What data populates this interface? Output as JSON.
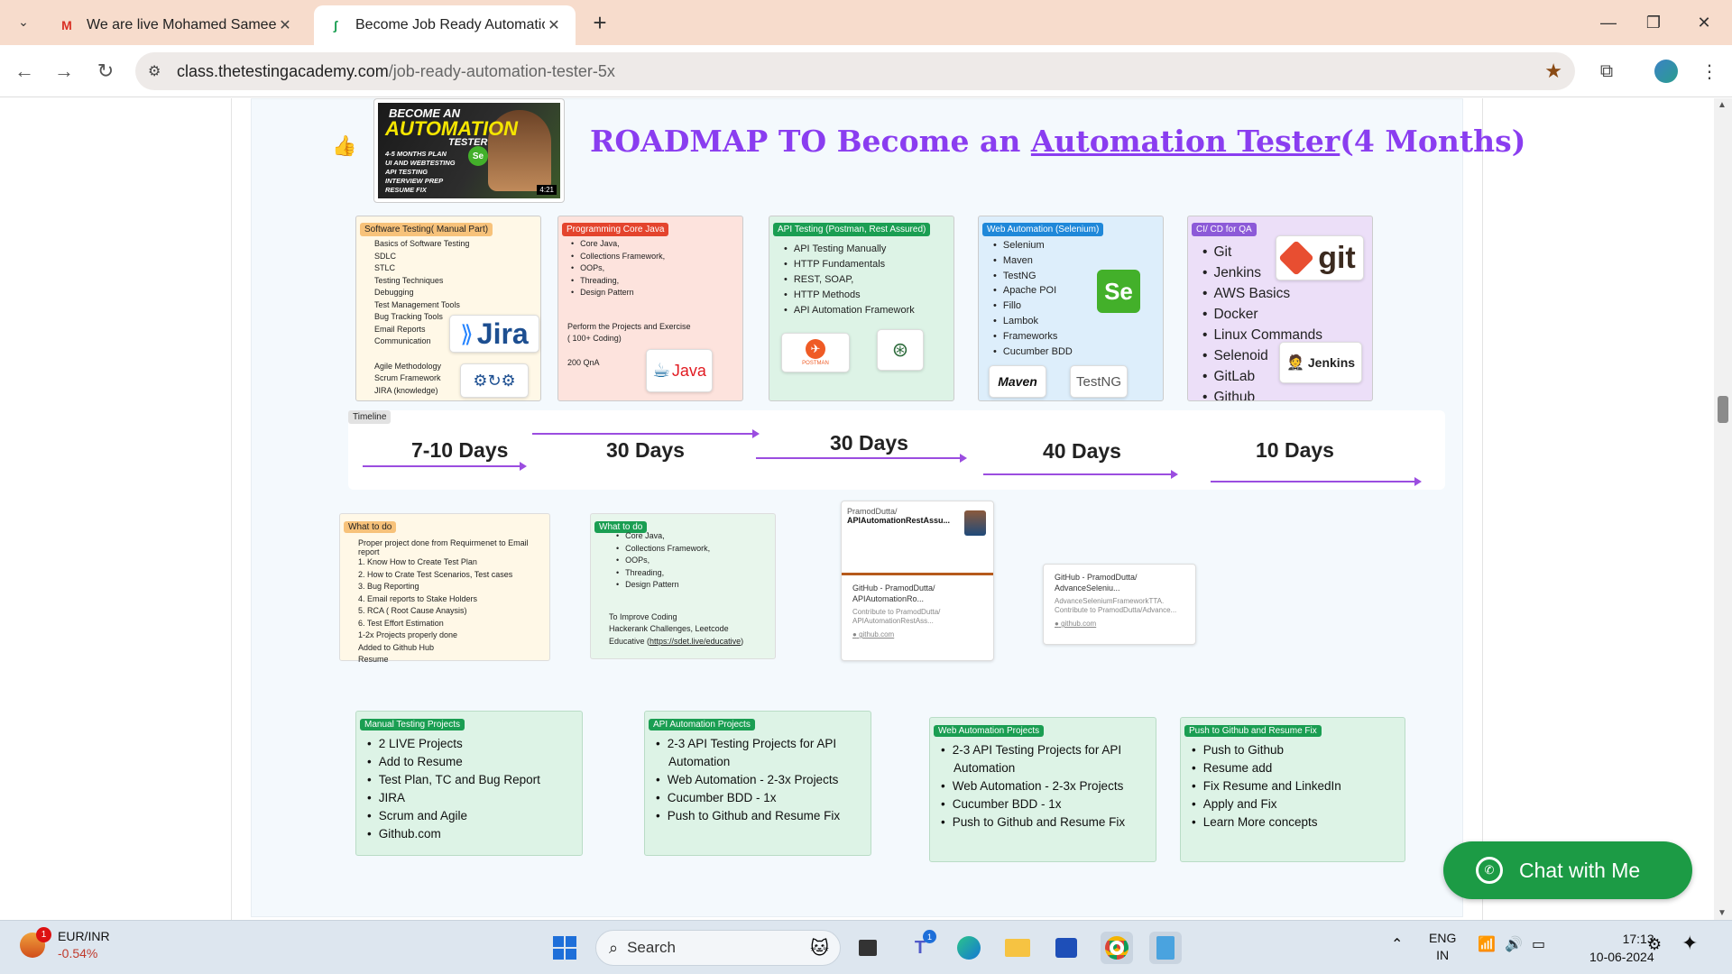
{
  "browser": {
    "tabs": [
      {
        "title": "We are live Mohamed Sameer -",
        "favicon": "gmail-icon",
        "active": false
      },
      {
        "title": "Become Job Ready Automation",
        "favicon": "page-icon",
        "active": true
      }
    ],
    "url_host": "class.thetestingacademy.com",
    "url_path": "/job-ready-automation-tester-5x"
  },
  "video": {
    "line1": "BECOME AN",
    "line2": "AUTOMATION",
    "line3": "TESTER",
    "bullets": [
      "4-5 MONTHS PLAN",
      "UI AND WEBTESTING",
      "API TESTING",
      "INTERVIEW PREP",
      "RESUME FIX"
    ],
    "duration": "4:21"
  },
  "roadmap": {
    "title_prefix": "ROADMAP TO Become an ",
    "title_link": "Automation Tester",
    "title_suffix": "(4 Months)"
  },
  "skills": {
    "manual": {
      "header": "Software Testing( Manual Part)",
      "items": [
        "Basics of Software Testing",
        "SDLC",
        "STLC",
        "Testing Techniques",
        "Debugging",
        "Test Management Tools",
        "Bug Tracking Tools",
        "Email Reports",
        "Communication"
      ],
      "items2": [
        "Agile Methodology",
        "Scrum Framework",
        "JIRA (knowledge)"
      ],
      "logo": "Jira"
    },
    "java": {
      "header": "Programming Core Java",
      "items": [
        "Core Java,",
        "Collections Framework,",
        "OOPs,",
        "Threading,",
        "Design Pattern"
      ],
      "note1": "Perform the Projects and Exercise",
      "note2": "( 100+ Coding)",
      "note3": "200 QnA",
      "logo": "Java"
    },
    "api": {
      "header": "API Testing (Postman, Rest Assured)",
      "items": [
        "API Testing Manually",
        "HTTP Fundamentals",
        "REST, SOAP,",
        "HTTP Methods",
        "API Automation Framework"
      ],
      "logo1": "POSTMAN"
    },
    "web": {
      "header": "Web Automation (Selenium)",
      "items": [
        "Selenium",
        "Maven",
        "TestNG",
        "Apache POI",
        "Fillo",
        "Lambok",
        "Frameworks",
        "Cucumber BDD"
      ],
      "logo_se": "Se",
      "logo_maven": "Maven",
      "logo_testng": "TestNG"
    },
    "cicd": {
      "header": "CI/ CD for QA",
      "items": [
        "Git",
        "Jenkins",
        "AWS Basics",
        "Docker",
        "Linux Commands",
        "Selenoid",
        "GitLab",
        "Github"
      ],
      "logo_git": "git",
      "logo_jenkins": "Jenkins"
    }
  },
  "timeline": {
    "tag": "Timeline",
    "labels": [
      "7-10 Days",
      "30 Days",
      "30 Days",
      "40 Days",
      "10 Days"
    ]
  },
  "todo": {
    "manual": {
      "header": "What to do",
      "intro": "Proper project done from Requirmenet to Email report",
      "items": [
        "1. Know How to Create Test Plan",
        "2. How to Crate Test Scenarios, Test cases",
        "3. Bug Reporting",
        "4. Email reports to Stake Holders",
        "5. RCA ( Root Cause Anaysis)",
        "6. Test Effort Estimation",
        "1-2x Projects properly done",
        "Added to Github Hub",
        "Resume"
      ]
    },
    "java": {
      "header": "What to do",
      "items": [
        "Core Java,",
        "Collections Framework,",
        "OOPs,",
        "Threading,",
        "Design Pattern"
      ],
      "extra1": "To Improve Coding",
      "extra2": "Hackerank Challenges, Leetcode",
      "extra3_prefix": "Educative (",
      "extra3_link": "https://sdet.live/educative",
      "extra3_suffix": ")"
    }
  },
  "github_cards": [
    {
      "owner": "PramodDutta/",
      "repo": "APIAutomationRestAssu...",
      "title": "GitHub - PramodDutta/ APIAutomationRo...",
      "desc": "Contribute to PramodDutta/ APIAutomationRestAss...",
      "domain": "github.com"
    },
    {
      "title": "GitHub - PramodDutta/ AdvanceSeleniu...",
      "desc": "AdvanceSeleniumFrameworkTTA. Contribute to PramodDutta/Advance...",
      "domain": "github.com"
    }
  ],
  "projects": [
    {
      "header": "Manual Testing Projects",
      "items": [
        "2 LIVE Projects",
        "Add to Resume",
        "Test Plan, TC and Bug Report",
        "JIRA",
        "Scrum and Agile",
        "Github.com"
      ]
    },
    {
      "header": "API Automation Projects",
      "items": [
        "2-3 API Testing Projects for API Automation",
        "Web Automation - 2-3x Projects",
        "Cucumber BDD - 1x",
        "Push to Github and Resume Fix"
      ]
    },
    {
      "header": "Web Automation Projects",
      "items": [
        "2-3 API Testing Projects for API Automation",
        "Web Automation - 2-3x Projects",
        "Cucumber BDD - 1x",
        "Push to Github and Resume Fix"
      ]
    },
    {
      "header": "Push to Github and Resume Fix",
      "items": [
        "Push to Github",
        "Resume add",
        "Fix Resume and LinkedIn",
        "Apply and Fix",
        "Learn More concepts"
      ]
    }
  ],
  "chat": {
    "label": "Chat with Me"
  },
  "taskbar": {
    "ticker_pair": "EUR/INR",
    "ticker_change": "-0.54%",
    "ticker_badge": "1",
    "search_label": "Search",
    "teams_badge": "1",
    "lang1": "ENG",
    "lang2": "IN",
    "time": "17:13",
    "date": "10-06-2024"
  }
}
